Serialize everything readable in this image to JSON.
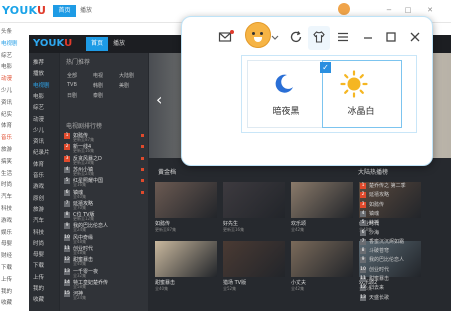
{
  "bg_window": {
    "logo_main": "YOUK",
    "logo_end": "U",
    "tab_active": "首页",
    "tab_2": "播放",
    "controls": [
      "−",
      "□",
      "✕"
    ],
    "sidebar": [
      "头条",
      "电视剧",
      "综艺",
      "电影",
      "动漫",
      "少儿",
      "资讯",
      "纪实",
      "体育",
      "音乐",
      "旅游",
      "搞笑",
      "生活",
      "时尚",
      "汽车",
      "科技",
      "游戏",
      "娱乐",
      "母婴",
      "财经",
      "下载",
      "上传",
      "我的",
      "收藏"
    ]
  },
  "dark_window": {
    "logo_main": "YOUK",
    "logo_end": "U",
    "tab_active": "首页",
    "tab_2": "播放",
    "sidebar": [
      "推荐",
      "播放",
      "电视剧",
      "电影",
      "综艺",
      "动漫",
      "少儿",
      "资讯",
      "纪录片",
      "体育",
      "音乐",
      "游戏",
      "原创",
      "旅游",
      "汽车",
      "科技",
      "时尚",
      "母婴",
      "下载",
      "上传",
      "我的",
      "收藏"
    ],
    "list_title": "热门推荐",
    "filters": [
      "全部",
      "电视",
      "大陆剧",
      "TVB",
      "韩剧",
      "美剧",
      "日剧",
      "泰剧"
    ],
    "rank_title": "电视剧排行榜",
    "rank": [
      {
        "num": "1",
        "name": "如懿传",
        "sub": "更新至87集"
      },
      {
        "num": "2",
        "name": "新一线4",
        "sub": "更新至16集"
      },
      {
        "num": "3",
        "name": "反贪风暴之D",
        "sub": "更新至28集"
      },
      {
        "num": "4",
        "name": "苏州小镇",
        "sub": "更新至24集"
      },
      {
        "num": "5",
        "name": "红星照耀中国",
        "sub": "全16集"
      },
      {
        "num": "6",
        "name": "镇魂",
        "sub": "全40集"
      },
      {
        "num": "7",
        "name": "延禧攻略",
        "sub": "全70集"
      },
      {
        "num": "8",
        "name": "C位 TV版",
        "sub": "更新至12集"
      },
      {
        "num": "9",
        "name": "我的巴比伦恋人",
        "sub": "全24集"
      },
      {
        "num": "10",
        "name": "风中奇缘",
        "sub": "全48集"
      },
      {
        "num": "11",
        "name": "创业时代",
        "sub": "全48集"
      },
      {
        "num": "12",
        "name": "甜蜜暴击",
        "sub": "全40集"
      },
      {
        "num": "13",
        "name": "一千零一夜",
        "sub": "全32集"
      },
      {
        "num": "14",
        "name": "特工皇妃楚乔传",
        "sub": "全58集"
      },
      {
        "num": "15",
        "name": "河神",
        "sub": "全24集"
      }
    ],
    "banner_arrow": "‹",
    "gold_title": "黄金档",
    "hot_title": "大陆热播榜",
    "thumbs": [
      {
        "cap": "如懿传",
        "sub": "更新至87集"
      },
      {
        "cap": "好先生",
        "sub": "更新至16集"
      },
      {
        "cap": "欢乐颂",
        "sub": "全42集"
      },
      {
        "cap": "创业时代",
        "sub": "全48集"
      },
      {
        "cap": "甜蜜暴击",
        "sub": "全40集"
      },
      {
        "cap": "猎场 TV版",
        "sub": "全52集"
      },
      {
        "cap": "小丈夫",
        "sub": "全42集"
      },
      {
        "cap": "欢乐颂2",
        "sub": "全55集"
      }
    ],
    "hot": [
      {
        "num": "1",
        "name": "楚乔传之 第二季"
      },
      {
        "num": "2",
        "name": "延禧攻略"
      },
      {
        "num": "3",
        "name": "如懿传"
      },
      {
        "num": "4",
        "name": "镇魂"
      },
      {
        "num": "5",
        "name": "扶摇"
      },
      {
        "num": "6",
        "name": "沙海"
      },
      {
        "num": "7",
        "name": "香蜜沉沉烬如霜"
      },
      {
        "num": "8",
        "name": "斗破苍穹"
      },
      {
        "num": "9",
        "name": "我的巴比伦恋人"
      },
      {
        "num": "10",
        "name": "创业时代"
      },
      {
        "num": "11",
        "name": "甜蜜暴击"
      },
      {
        "num": "12",
        "name": "归去来"
      },
      {
        "num": "13",
        "name": "天盛长歌"
      }
    ]
  },
  "popup": {
    "icons": [
      "mail-icon",
      "mascot-avatar",
      "chevron-down-icon",
      "refresh-icon",
      "skin-shirt-icon",
      "menu-icon",
      "minimize-icon",
      "maximize-icon",
      "close-icon"
    ],
    "skins": [
      {
        "label": "暗夜黑",
        "selected": false
      },
      {
        "label": "冰晶白",
        "selected": true
      }
    ],
    "accent": "#2a8fe0"
  }
}
